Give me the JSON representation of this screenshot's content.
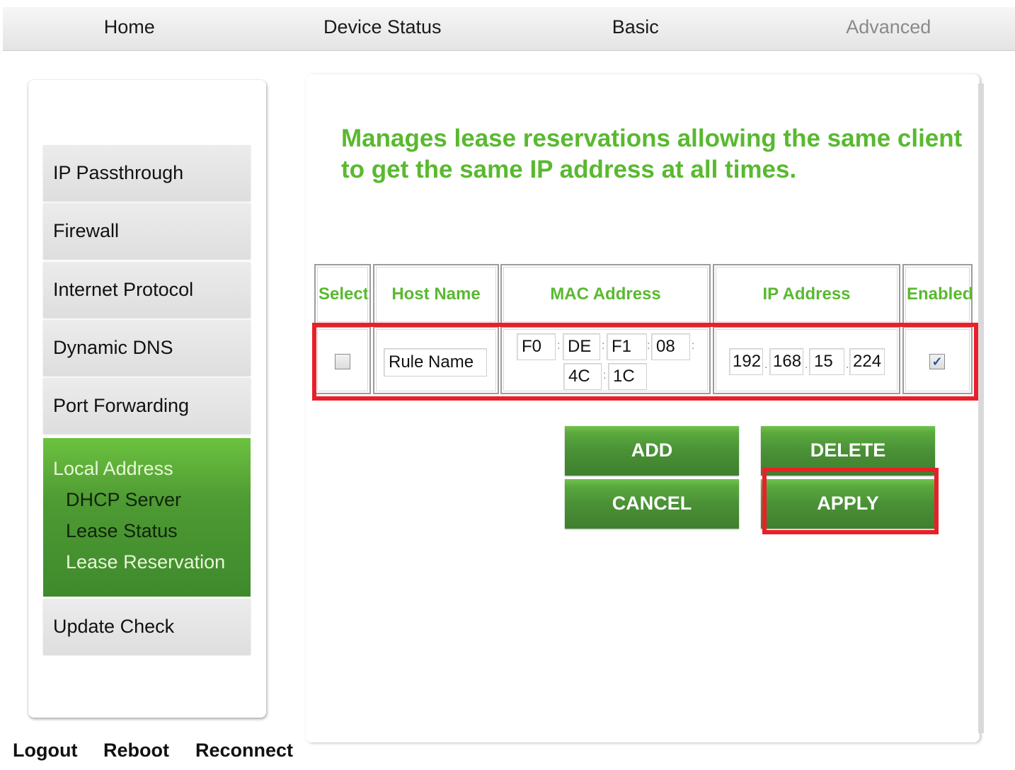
{
  "nav": {
    "tabs": [
      {
        "label": "Home"
      },
      {
        "label": "Device Status"
      },
      {
        "label": "Basic"
      },
      {
        "label": "Advanced"
      }
    ]
  },
  "sidebar": {
    "items": [
      {
        "label": "IP Passthrough"
      },
      {
        "label": "Firewall"
      },
      {
        "label": "Internet Protocol"
      },
      {
        "label": "Dynamic DNS"
      },
      {
        "label": "Port Forwarding"
      }
    ],
    "active_group": {
      "label": "Local Address",
      "subitems": [
        {
          "label": "DHCP Server"
        },
        {
          "label": "Lease Status"
        },
        {
          "label": "Lease Reservation"
        }
      ]
    },
    "after_items": [
      {
        "label": "Update Check"
      }
    ]
  },
  "footer": {
    "logout": "Logout",
    "reboot": "Reboot",
    "reconnect": "Reconnect"
  },
  "main": {
    "description": "Manages lease reservations allowing the same client to get the same IP address at all times.",
    "table": {
      "headers": {
        "select": "Select",
        "host_name": "Host Name",
        "mac_address": "MAC Address",
        "ip_address": "IP Address",
        "enabled": "Enabled"
      },
      "row": {
        "select_checked": false,
        "host_name": "Rule Name",
        "mac": [
          "F0",
          "DE",
          "F1",
          "08",
          "4C",
          "1C"
        ],
        "ip": [
          "192",
          "168",
          "15",
          "224"
        ],
        "enabled_checked": true,
        "mac_separator": ":",
        "ip_separator": "."
      }
    },
    "buttons": {
      "add": "ADD",
      "delete": "DELETE",
      "cancel": "CANCEL",
      "apply": "APPLY"
    }
  },
  "colors": {
    "accent_green": "#59b92f",
    "button_green": "#4a9136",
    "highlight_red": "#e8202a"
  }
}
